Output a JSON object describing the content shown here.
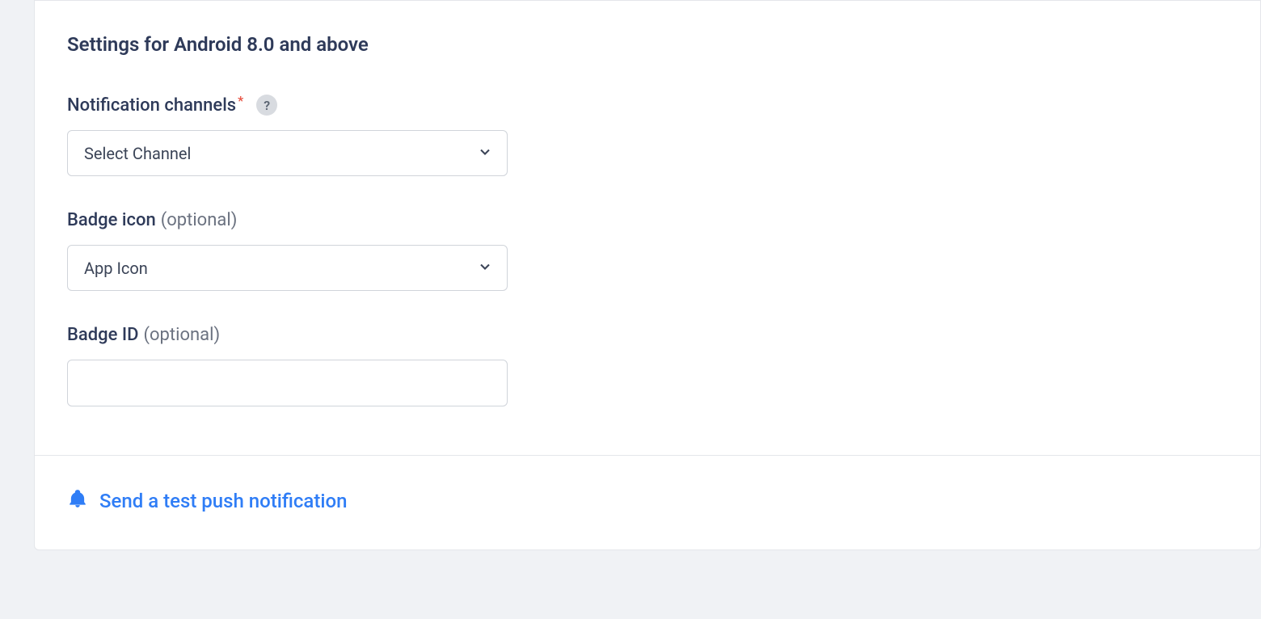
{
  "section": {
    "title": "Settings for Android 8.0 and above"
  },
  "fields": {
    "channels": {
      "label": "Notification channels",
      "required_mark": "*",
      "selected": "Select Channel"
    },
    "badge_icon": {
      "label": "Badge icon",
      "optional_text": "(optional)",
      "selected": "App Icon"
    },
    "badge_id": {
      "label": "Badge ID",
      "optional_text": "(optional)",
      "value": ""
    }
  },
  "footer": {
    "test_link": "Send a test push notification"
  },
  "icons": {
    "help": "?"
  }
}
